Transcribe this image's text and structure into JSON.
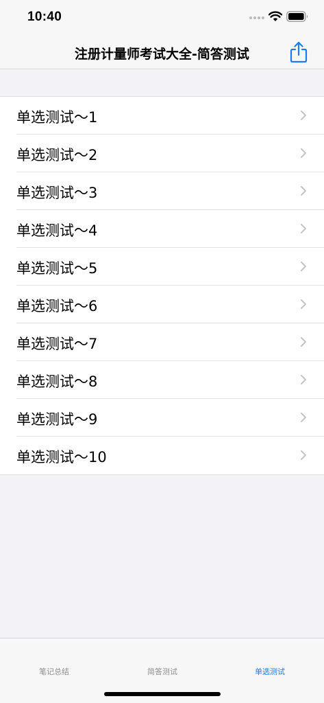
{
  "status_bar": {
    "time": "10:40"
  },
  "nav": {
    "title": "注册计量师考试大全-简答测试",
    "share_icon": "share-icon"
  },
  "list": {
    "items": [
      {
        "label": "单选测试～1"
      },
      {
        "label": "单选测试～2"
      },
      {
        "label": "单选测试～3"
      },
      {
        "label": "单选测试～4"
      },
      {
        "label": "单选测试～5"
      },
      {
        "label": "单选测试～6"
      },
      {
        "label": "单选测试～7"
      },
      {
        "label": "单选测试～8"
      },
      {
        "label": "单选测试～9"
      },
      {
        "label": "单选测试～10"
      }
    ]
  },
  "tabs": [
    {
      "label": "笔记总结",
      "active": false
    },
    {
      "label": "简答测试",
      "active": false
    },
    {
      "label": "单选测试",
      "active": true
    }
  ],
  "colors": {
    "accent": "#1a7cf0",
    "inactive_tab": "#8e8e93",
    "chevron": "#c4c4c7"
  }
}
